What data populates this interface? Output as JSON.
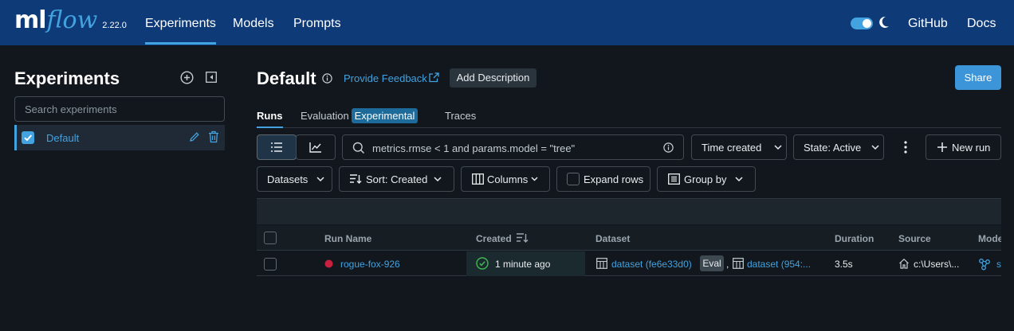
{
  "nav": {
    "logo_ml": "ml",
    "logo_flow": "flow",
    "version": "2.22.0",
    "links": [
      "Experiments",
      "Models",
      "Prompts"
    ],
    "active_link": "Experiments",
    "github": "GitHub",
    "docs": "Docs",
    "theme_toggle_on": true
  },
  "sidebar": {
    "title": "Experiments",
    "search_placeholder": "Search experiments",
    "items": [
      {
        "label": "Default",
        "checked": true
      }
    ]
  },
  "main": {
    "title": "Default",
    "feedback_label": "Provide Feedback",
    "add_description": "Add Description",
    "share": "Share",
    "tabs": {
      "runs": "Runs",
      "evaluation": "Evaluation",
      "experimental_badge": "Experimental",
      "traces": "Traces"
    },
    "toolbar": {
      "filter_text": "metrics.rmse < 1 and params.model = \"tree\"",
      "time_created": "Time created",
      "state": "State: Active",
      "new_run": "New run",
      "datasets": "Datasets",
      "sort": "Sort: Created",
      "columns": "Columns",
      "expand_rows": "Expand rows",
      "group_by": "Group by"
    },
    "table": {
      "headers": [
        "Run Name",
        "Created",
        "Dataset",
        "Duration",
        "Source",
        "Mode"
      ],
      "rows": [
        {
          "run_name": "rogue-fox-926",
          "created": "1 minute ago",
          "dataset1": "dataset (fe6e33d0)",
          "eval_badge": "Eval",
          "separator": ",",
          "dataset2": "dataset (954:...",
          "duration": "3.5s",
          "source": "c:\\Users\\...",
          "model": "s"
        }
      ]
    }
  },
  "colors": {
    "nav_bg": "#0e3a78",
    "accent": "#43a2e0",
    "page_bg": "#11171c",
    "run_dot": "#c8203f",
    "success": "#3fb950"
  }
}
